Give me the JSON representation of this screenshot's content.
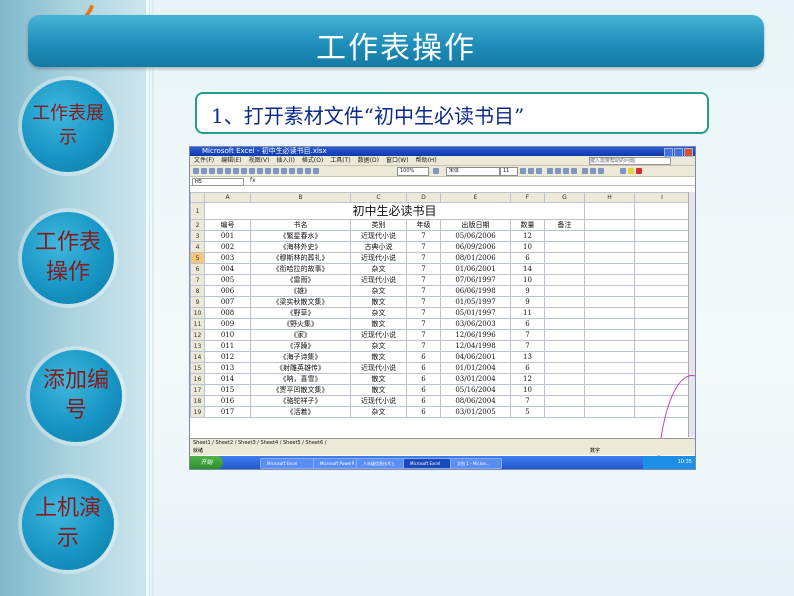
{
  "slide": {
    "title": "工作表操作",
    "instruction": "1、打开素材文件“初中生必读书目”"
  },
  "nav": [
    {
      "label": "工作表展示"
    },
    {
      "label": "工作表操作"
    },
    {
      "label": "添加编号"
    },
    {
      "label": "上机演示"
    }
  ],
  "excel": {
    "window_title": "Microsoft Excel - 初中生必读书目.xlsx",
    "menu": [
      "文件(F)",
      "编辑(E)",
      "视图(V)",
      "插入(I)",
      "格式(O)",
      "工具(T)",
      "数据(D)",
      "窗口(W)",
      "帮助(H)"
    ],
    "help_box": "键入需要帮助的问题",
    "font_name": "宋体",
    "font_size": "11",
    "zoom": "100%",
    "name_box": "H5",
    "fx": "fx",
    "columns": [
      "A",
      "B",
      "C",
      "D",
      "E",
      "F",
      "G",
      "H",
      "I"
    ],
    "sheet_title": "初中生必读书目",
    "headers": [
      "编号",
      "书名",
      "类别",
      "年级",
      "出版日期",
      "数量",
      "备注"
    ],
    "rows": [
      [
        "001",
        "《繁星春水》",
        "近现代小说",
        "7",
        "05/06/2006",
        "12",
        ""
      ],
      [
        "002",
        "《海林外史》",
        "古典小说",
        "7",
        "06/09/2006",
        "10",
        ""
      ],
      [
        "003",
        "《穆斯林的葬礼》",
        "近现代小说",
        "7",
        "08/01/2006",
        "6",
        ""
      ],
      [
        "004",
        "《衔哈拉的故事》",
        "杂文",
        "7",
        "01/06/2001",
        "14",
        ""
      ],
      [
        "005",
        "《雷雨》",
        "近现代小说",
        "7",
        "07/06/1997",
        "10",
        ""
      ],
      [
        "006",
        "《雄》",
        "杂文",
        "7",
        "06/06/1998",
        "9",
        ""
      ],
      [
        "007",
        "《梁实秋散文集》",
        "散文",
        "7",
        "01/05/1997",
        "9",
        ""
      ],
      [
        "008",
        "《野草》",
        "杂文",
        "7",
        "05/01/1997",
        "11",
        ""
      ],
      [
        "009",
        "《野火集》",
        "散文",
        "7",
        "03/06/2003",
        "6",
        ""
      ],
      [
        "010",
        "《家》",
        "近现代小说",
        "7",
        "12/06/1996",
        "7",
        ""
      ],
      [
        "011",
        "《浮躁》",
        "杂文",
        "7",
        "12/04/1998",
        "7",
        ""
      ],
      [
        "012",
        "《海子诗集》",
        "散文",
        "6",
        "04/06/2001",
        "13",
        ""
      ],
      [
        "013",
        "《射雕英雄传》",
        "近现代小说",
        "6",
        "01/01/2004",
        "6",
        ""
      ],
      [
        "014",
        "《呐，喜雪》",
        "散文",
        "6",
        "03/01/2004",
        "12",
        ""
      ],
      [
        "015",
        "《贾平凹散文集》",
        "散文",
        "6",
        "05/16/2004",
        "10",
        ""
      ],
      [
        "016",
        "《骆驼祥子》",
        "近现代小说",
        "6",
        "08/06/2004",
        "7",
        ""
      ],
      [
        "017",
        "《活着》",
        "杂文",
        "6",
        "03/01/2005",
        "5",
        ""
      ]
    ],
    "sheet_tabs": "Sheet1 / Sheet2 / Sheet3 / Sheet4 / Sheet5 / Sheet6 /",
    "status_left": "就绪",
    "status_right": "数字",
    "start_label": "开始",
    "taskbar_items": [
      "Microsoft Excel",
      "Microsoft PowerP...",
      "八年级信息技术上",
      "Microsoft Excel",
      "文档 1 - Micros..."
    ],
    "clock": "10:35"
  }
}
